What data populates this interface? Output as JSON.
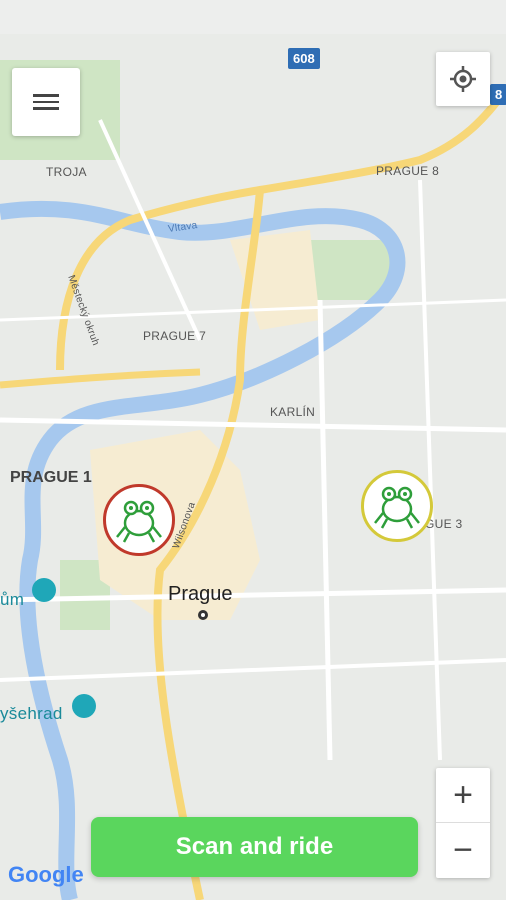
{
  "map": {
    "labels": {
      "troja": "TROJA",
      "prague8": "PRAGUE 8",
      "prague7": "PRAGUE 7",
      "karlin": "KARLÍN",
      "prague1": "PRAGUE 1",
      "prague3": "GUE 3",
      "prague": "Prague",
      "vltava": "Vltava",
      "wilsonova": "Wilsonova",
      "mistecky": "Městecký okruh",
      "muzeum": "ům",
      "vysehrad": "yšehrad"
    },
    "road_signs": {
      "r608": "608",
      "r8": "8"
    },
    "attribution": "Google"
  },
  "buttons": {
    "scan": "Scan and ride",
    "zoom_in": "+",
    "zoom_out": "−"
  },
  "colors": {
    "scan_button": "#5ad65d",
    "frog_red_ring": "#c0392b",
    "frog_yellow_ring": "#d4c93a",
    "water": "#a6c8ee",
    "road": "#f7d778"
  }
}
